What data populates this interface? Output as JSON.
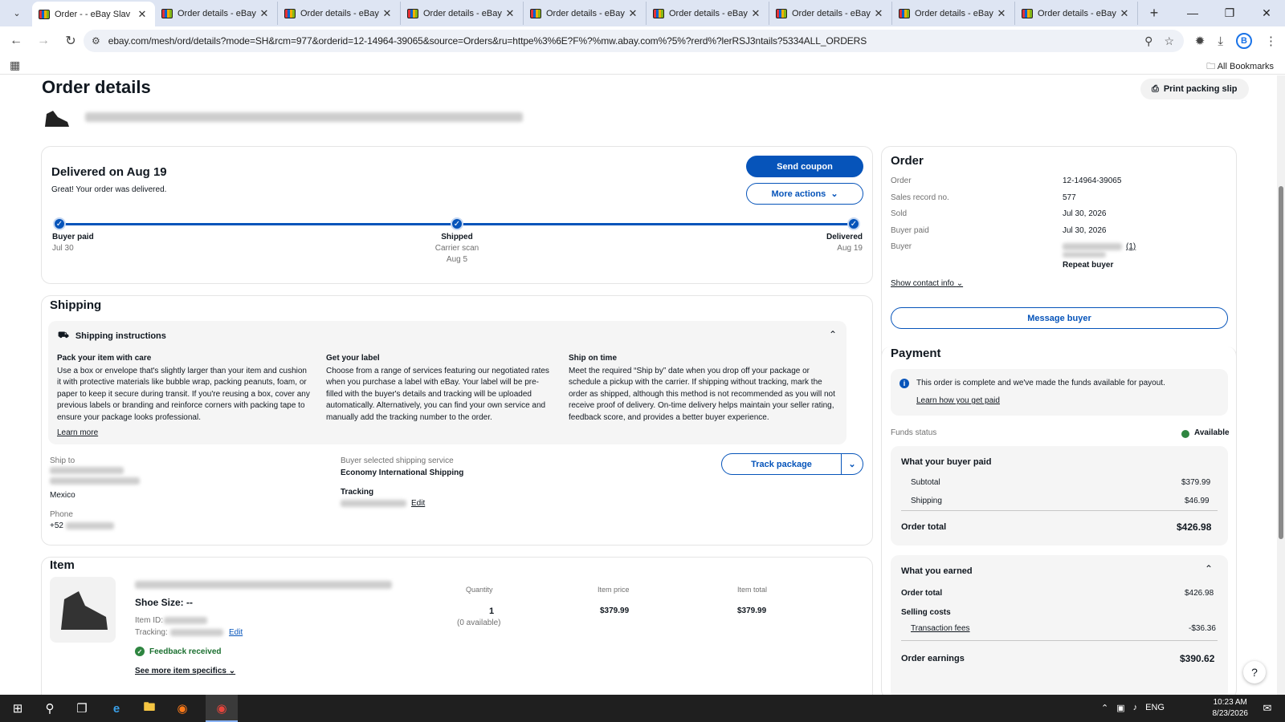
{
  "browser": {
    "tabs": [
      {
        "title": "Order  - - eBay Slav"
      },
      {
        "title": "Order details - eBay"
      },
      {
        "title": "Order details - eBay"
      },
      {
        "title": "Order details - eBay"
      },
      {
        "title": "Order details - eBay"
      },
      {
        "title": "Order details - eBay"
      },
      {
        "title": "Order details - eBay"
      },
      {
        "title": "Order details - eBay"
      },
      {
        "title": "Order details - eBay"
      }
    ],
    "url": "ebay.com/mesh/ord/details?mode=SH&rcm=977&orderid=12-14964-39065&source=Orders&ru=httpe%3%6E?F%?%mw.abay.com%?5%?rerd%?lerRSJ3ntails?5334ALL_ORDERS",
    "all_bookmarks": "All Bookmarks"
  },
  "page": {
    "title": "Order details",
    "print_label": "Print packing slip"
  },
  "status": {
    "heading": "Delivered on Aug 19",
    "message": "Great! Your order was delivered.",
    "send_coupon": "Send coupon",
    "more_actions": "More actions",
    "steps": [
      {
        "label": "Buyer paid",
        "sub1": "Jul 30",
        "sub2": ""
      },
      {
        "label": "Shipped",
        "sub1": "Carrier scan",
        "sub2": "Aug 5"
      },
      {
        "label": "Delivered",
        "sub1": "Aug 19",
        "sub2": ""
      }
    ]
  },
  "shipping": {
    "title": "Shipping",
    "instructions_title": "Shipping instructions",
    "col1_title": "Pack your item with care",
    "col1_text": "Use a box or envelope that's slightly larger than your item and cushion it with protective materials like bubble wrap, packing peanuts, foam, or paper to keep it secure during transit. If you're reusing a box, cover any previous labels or branding and reinforce corners with packing tape to ensure your package looks professional.",
    "col2_title": "Get your label",
    "col2_text": "Choose from a range of services featuring our negotiated rates when you purchase a label with eBay. Your label will be pre-filled with the buyer's details and tracking will be uploaded automatically. Alternatively, you can find your own service and manually add the tracking number to the order.",
    "col3_title": "Ship on time",
    "col3_text": "Meet the required “Ship by” date when you drop off your package or schedule a pickup with the carrier. If shipping without tracking, mark the order as shipped, although this method is not recommended as you will not receive proof of delivery. On-time delivery helps maintain your seller rating, feedback score, and provides a better buyer experience.",
    "learn_more": "Learn more",
    "ship_to_label": "Ship to",
    "country": "Mexico",
    "phone_label": "Phone",
    "phone_prefix": "+52",
    "service_label": "Buyer selected shipping service",
    "service_value": "Economy International Shipping",
    "tracking_label": "Tracking",
    "edit": "Edit",
    "track_package": "Track package"
  },
  "item": {
    "title": "Item",
    "shoe_size": "Shoe Size: --",
    "item_id_label": "Item ID:",
    "tracking_label": "Tracking:",
    "edit": "Edit",
    "feedback": "Feedback received",
    "see_more": "See more item specifics",
    "quantity_header": "Quantity",
    "price_header": "Item price",
    "total_header": "Item total",
    "quantity": "1",
    "available": "(0 available)",
    "price": "$379.99",
    "total": "$379.99"
  },
  "order": {
    "title": "Order",
    "rows": [
      {
        "label": "Order",
        "value": "12-14964-39065"
      },
      {
        "label": "Sales record no.",
        "value": "577"
      },
      {
        "label": "Sold",
        "value": "Jul 30, 2026"
      },
      {
        "label": "Buyer paid",
        "value": "Jul 30, 2026"
      }
    ],
    "buyer_label": "Buyer",
    "buyer_count": "(1)",
    "repeat_buyer": "Repeat buyer",
    "show_contact": "Show contact info",
    "message_buyer": "Message buyer"
  },
  "payment": {
    "title": "Payment",
    "notice": "This order is complete and we've made the funds available for payout.",
    "learn_link": "Learn how you get paid",
    "funds_status_label": "Funds status",
    "funds_status_value": "Available",
    "buyer_paid_title": "What your buyer paid",
    "subtotal_label": "Subtotal",
    "subtotal": "$379.99",
    "shipping_label": "Shipping",
    "shipping": "$46.99",
    "order_total_label": "Order total",
    "order_total": "$426.98",
    "earned_title": "What you earned",
    "earned_order_total_label": "Order total",
    "earned_order_total": "$426.98",
    "selling_costs": "Selling costs",
    "transaction_fees_label": "Transaction fees",
    "transaction_fees": "-$36.36",
    "earnings_label": "Order earnings",
    "earnings": "$390.62"
  },
  "taskbar": {
    "time": "10:23 AM",
    "date": "8/23/2026",
    "lang": "ENG"
  },
  "colors": {
    "ebay_blue": "#0654ba",
    "available_green": "#2e8540"
  }
}
